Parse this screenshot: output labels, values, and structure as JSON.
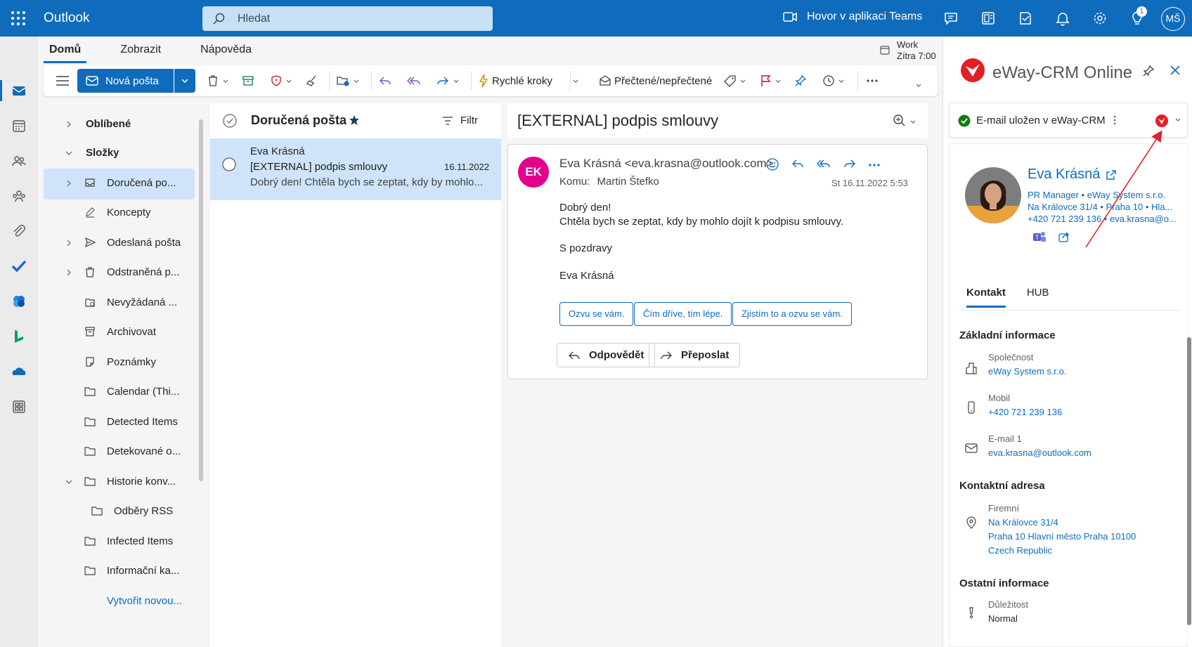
{
  "app": {
    "title": "Outlook"
  },
  "search": {
    "placeholder": "Hledat"
  },
  "topbar": {
    "teams_call": "Hovor v aplikaci Teams",
    "initials": "MŠ",
    "notification_count": "1"
  },
  "tabs": [
    "Domů",
    "Zobrazit",
    "Nápověda"
  ],
  "work": {
    "line1": "Work",
    "line2": "Zítra 7:00"
  },
  "ribbon": {
    "new_mail": "Nová pošta",
    "quick_steps": "Rychlé kroky",
    "read_unread": "Přečtené/nepřečtené"
  },
  "folders": [
    {
      "label": "Oblíbené",
      "type": "head",
      "expand": "right"
    },
    {
      "label": "Složky",
      "type": "head",
      "expand": "down"
    },
    {
      "label": "Doručená po...",
      "icon": "inbox-icon",
      "expand": "right",
      "selected": true
    },
    {
      "label": "Koncepty",
      "icon": "drafts-icon"
    },
    {
      "label": "Odeslaná pošta",
      "icon": "sent-icon",
      "expand": "right"
    },
    {
      "label": "Odstraněná p...",
      "icon": "trash-icon",
      "expand": "right"
    },
    {
      "label": "Nevyžádaná ...",
      "icon": "junk-icon"
    },
    {
      "label": "Archivovat",
      "icon": "archive-icon"
    },
    {
      "label": "Poznámky",
      "icon": "notes-icon"
    },
    {
      "label": "Calendar (Thi...",
      "icon": "folder-icon"
    },
    {
      "label": "Detected Items",
      "icon": "folder-icon"
    },
    {
      "label": "Detekované o...",
      "icon": "folder-icon"
    },
    {
      "label": "Historie konv...",
      "icon": "folder-icon",
      "expand": "down"
    },
    {
      "label": "Odběry RSS",
      "icon": "folder-icon",
      "indent": true
    },
    {
      "label": "Infected Items",
      "icon": "folder-icon"
    },
    {
      "label": "Informační ka...",
      "icon": "folder-icon"
    },
    {
      "label": "Vytvořit novou...",
      "type": "link"
    }
  ],
  "message_list": {
    "title": "Doručená pošta",
    "filter": "Filtr",
    "messages": [
      {
        "from": "Eva Krásná",
        "subject": "[EXTERNAL] podpis smlouvy",
        "date": "16.11.2022",
        "preview": "Dobrý den! Chtěla bych se zeptat, kdy by mohlo..."
      }
    ]
  },
  "reading": {
    "subject": "[EXTERNAL] podpis smlouvy",
    "sender_initials": "EK",
    "from": "Eva Krásná <eva.krasna@outlook.com>",
    "to_label": "Komu:",
    "to": "Martin Štefko",
    "date": "St 16.11.2022 5:53",
    "body": [
      "Dobrý den!",
      "Chtěla bych se zeptat, kdy by mohlo dojít k podpisu smlouvy.",
      "S pozdravy",
      "Eva Krásná"
    ],
    "suggestions": [
      "Ozvu se vám.",
      "Čím dříve, tím lépe.",
      "Zjistím to a ozvu se vám."
    ],
    "reply": "Odpovědět",
    "forward": "Přeposlat"
  },
  "addin": {
    "title": "eWay-CRM Online",
    "status": "E-mail uložen v eWay-CRM",
    "contact": {
      "name": "Eva Krásná",
      "line1": "PR Manager  •  eWay System s.r.o.",
      "line2": "Na Královce 31/4  •  Praha 10  •  Hla...",
      "line3": "+420 721 239 136  •  eva.krasna@o..."
    },
    "tabs": [
      "Kontakt",
      "HUB"
    ],
    "sections": {
      "basic": "Základní informace",
      "company_label": "Společnost",
      "company": "eWay System s.r.o.",
      "mobile_label": "Mobil",
      "mobile": "+420 721 239 136",
      "email_label": "E-mail 1",
      "email": "eva.krasna@outlook.com",
      "address": "Kontaktní adresa",
      "address_label": "Firemní",
      "address_line1": "Na Královce 31/4",
      "address_line2": "Praha 10 Hlavní město Praha 10100",
      "address_line3": "Czech Republic",
      "other": "Ostatní informace",
      "importance_label": "Důležitost",
      "importance": "Normal"
    }
  },
  "colors": {
    "brand": "#0f6cbd",
    "selected": "#cfe4fa",
    "avatar": "#e3008c",
    "annotation": "#d9262c"
  }
}
